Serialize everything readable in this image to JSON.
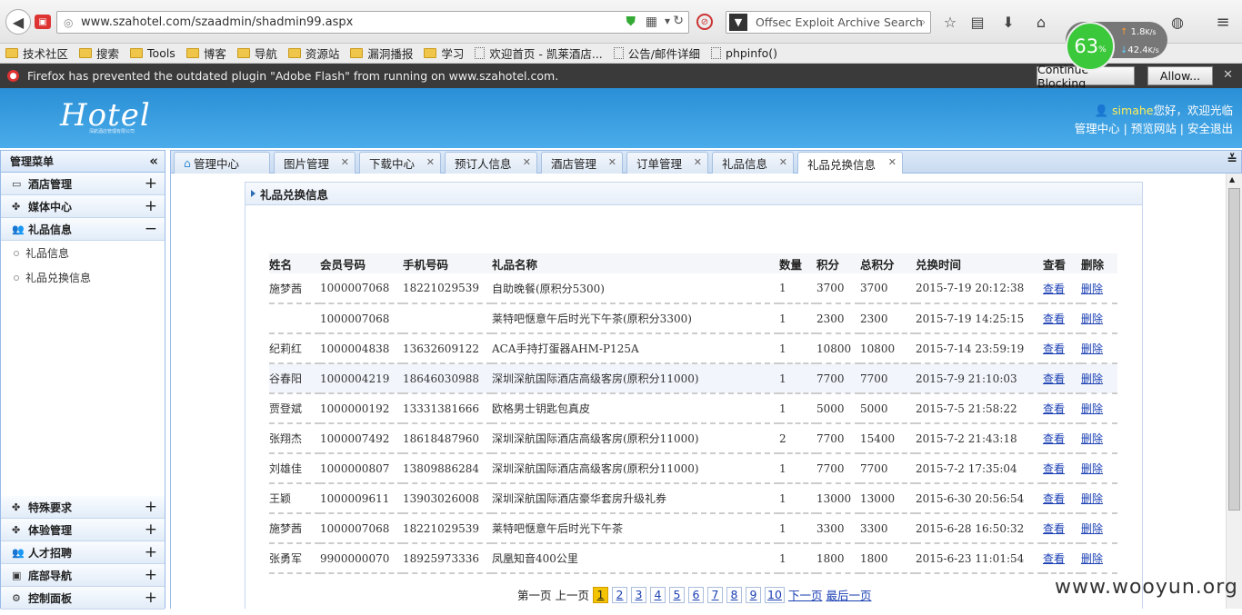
{
  "browser": {
    "url": "www.szahotel.com/szaadmin/shadmin99.aspx",
    "search": "Offsec Exploit Archive Search",
    "speed_pct": "63",
    "speed_unit": "%",
    "upload": "1.8",
    "download": "42.4",
    "rate_unit": "K/s",
    "bookmarks": [
      "技术社区",
      "搜索",
      "Tools",
      "博客",
      "导航",
      "资源站",
      "漏洞播报",
      "学习",
      "欢迎首页 - 凯莱酒店...",
      "公告/邮件详细",
      "phpinfo()"
    ],
    "notification": "Firefox has prevented the outdated plugin \"Adobe Flash\" from running on www.szahotel.com.",
    "continue_blocking": "Continue Blocking",
    "allow": "Allow..."
  },
  "header": {
    "logo": "Hotel",
    "logo_sub": "深航酒店管理有限公司",
    "username": "simahe",
    "greeting": "您好，欢迎光临",
    "links": "管理中心 | 预览网站 | 安全退出"
  },
  "sidebar": {
    "title": "管理菜单",
    "groups_top": [
      {
        "label": "酒店管理",
        "icon": "monitor-icon"
      },
      {
        "label": "媒体中心",
        "icon": "leaf-icon"
      }
    ],
    "expanded": {
      "label": "礼品信息",
      "items": [
        "礼品信息",
        "礼品兑换信息"
      ]
    },
    "groups_bottom": [
      {
        "label": "特殊要求"
      },
      {
        "label": "体验管理"
      },
      {
        "label": "人才招聘"
      },
      {
        "label": "底部导航"
      },
      {
        "label": "控制面板"
      }
    ]
  },
  "tabs": [
    "管理中心",
    "图片管理",
    "下载中心",
    "预订人信息",
    "酒店管理",
    "订单管理",
    "礼品信息",
    "礼品兑换信息"
  ],
  "panel_title": "礼品兑换信息",
  "table": {
    "headers": [
      "姓名",
      "会员号码",
      "手机号码",
      "礼品名称",
      "数量",
      "积分",
      "总积分",
      "兑换时间",
      "查看",
      "删除"
    ],
    "view_label": "查看",
    "delete_label": "删除",
    "rows": [
      [
        "施梦茜",
        "1000007068",
        "18221029539",
        "自助晚餐(原积分5300)",
        "1",
        "3700",
        "3700",
        "2015-7-19 20:12:38"
      ],
      [
        "",
        "1000007068",
        "",
        "莱特吧惬意午后时光下午茶(原积分3300)",
        "1",
        "2300",
        "2300",
        "2015-7-19 14:25:15"
      ],
      [
        "纪莉红",
        "1000004838",
        "13632609122",
        "ACA手持打蛋器AHM-P125A",
        "1",
        "10800",
        "10800",
        "2015-7-14 23:59:19"
      ],
      [
        "谷春阳",
        "1000004219",
        "18646030988",
        "深圳深航国际酒店高级客房(原积分11000)",
        "1",
        "7700",
        "7700",
        "2015-7-9 21:10:03"
      ],
      [
        "贾登斌",
        "1000000192",
        "13331381666",
        "欧格男士钥匙包真皮",
        "1",
        "5000",
        "5000",
        "2015-7-5 21:58:22"
      ],
      [
        "张翔杰",
        "1000007492",
        "18618487960",
        "深圳深航国际酒店高级客房(原积分11000)",
        "2",
        "7700",
        "15400",
        "2015-7-2 21:43:18"
      ],
      [
        "刘雄佳",
        "1000000807",
        "13809886284",
        "深圳深航国际酒店高级客房(原积分11000)",
        "1",
        "7700",
        "7700",
        "2015-7-2 17:35:04"
      ],
      [
        "王颖",
        "1000009611",
        "13903026008",
        "深圳深航国际酒店豪华套房升级礼券",
        "1",
        "13000",
        "13000",
        "2015-6-30 20:56:54"
      ],
      [
        "施梦茜",
        "1000007068",
        "18221029539",
        "莱特吧惬意午后时光下午茶",
        "1",
        "3300",
        "3300",
        "2015-6-28 16:50:32"
      ],
      [
        "张勇军",
        "9900000070",
        "18925973336",
        "凤凰知音400公里",
        "1",
        "1800",
        "1800",
        "2015-6-23 11:01:54"
      ]
    ]
  },
  "pagination": {
    "first": "第一页",
    "prev": "上一页",
    "pages": [
      "1",
      "2",
      "3",
      "4",
      "5",
      "6",
      "7",
      "8",
      "9",
      "10"
    ],
    "current": "1",
    "next": "下一页",
    "last": "最后一页"
  },
  "watermark": "www.wooyun.org"
}
